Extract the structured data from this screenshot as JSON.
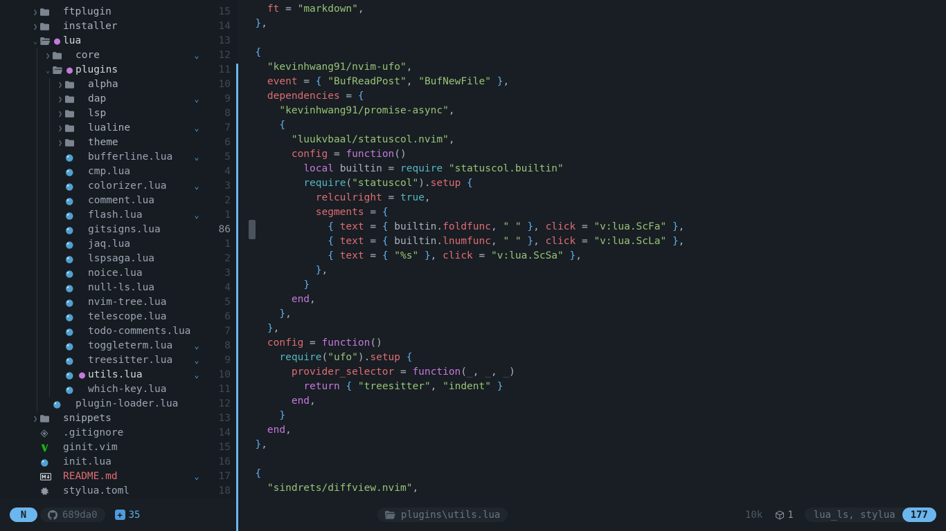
{
  "sidebar": {
    "name": "file-explorer",
    "items": [
      {
        "depth": 1,
        "type": "folder",
        "state": "closed",
        "label": "ftplugin",
        "num": "15",
        "fold": false,
        "mod": false
      },
      {
        "depth": 1,
        "type": "folder",
        "state": "closed",
        "label": "installer",
        "num": "14",
        "fold": false,
        "mod": false
      },
      {
        "depth": 1,
        "type": "folder",
        "state": "open",
        "label": "lua",
        "num": "13",
        "fold": false,
        "mod": true
      },
      {
        "depth": 2,
        "type": "folder",
        "state": "closed",
        "label": "core",
        "num": "12",
        "fold": true,
        "mod": false
      },
      {
        "depth": 2,
        "type": "folder",
        "state": "open",
        "label": "plugins",
        "num": "11",
        "fold": false,
        "mod": true
      },
      {
        "depth": 3,
        "type": "folder",
        "state": "closed",
        "label": "alpha",
        "num": "10",
        "fold": false,
        "mod": false
      },
      {
        "depth": 3,
        "type": "folder",
        "state": "closed",
        "label": "dap",
        "num": "9",
        "fold": true,
        "mod": false
      },
      {
        "depth": 3,
        "type": "folder",
        "state": "closed",
        "label": "lsp",
        "num": "8",
        "fold": false,
        "mod": false
      },
      {
        "depth": 3,
        "type": "folder",
        "state": "closed",
        "label": "lualine",
        "num": "7",
        "fold": true,
        "mod": false
      },
      {
        "depth": 3,
        "type": "folder",
        "state": "closed",
        "label": "theme",
        "num": "6",
        "fold": false,
        "mod": false
      },
      {
        "depth": 3,
        "type": "lua",
        "label": "bufferline.lua",
        "num": "5",
        "fold": true,
        "mod": false
      },
      {
        "depth": 3,
        "type": "lua",
        "label": "cmp.lua",
        "num": "4",
        "fold": false,
        "mod": false
      },
      {
        "depth": 3,
        "type": "lua",
        "label": "colorizer.lua",
        "num": "3",
        "fold": true,
        "mod": false
      },
      {
        "depth": 3,
        "type": "lua",
        "label": "comment.lua",
        "num": "2",
        "fold": false,
        "mod": false
      },
      {
        "depth": 3,
        "type": "lua",
        "label": "flash.lua",
        "num": "1",
        "fold": true,
        "mod": false
      },
      {
        "depth": 3,
        "type": "lua",
        "label": "gitsigns.lua",
        "num": "86",
        "current": true,
        "fold": false,
        "mod": false
      },
      {
        "depth": 3,
        "type": "lua",
        "label": "jaq.lua",
        "num": "1",
        "fold": false,
        "mod": false
      },
      {
        "depth": 3,
        "type": "lua",
        "label": "lspsaga.lua",
        "num": "2",
        "fold": false,
        "mod": false
      },
      {
        "depth": 3,
        "type": "lua",
        "label": "noice.lua",
        "num": "3",
        "fold": false,
        "mod": false
      },
      {
        "depth": 3,
        "type": "lua",
        "label": "null-ls.lua",
        "num": "4",
        "fold": false,
        "mod": false
      },
      {
        "depth": 3,
        "type": "lua",
        "label": "nvim-tree.lua",
        "num": "5",
        "fold": false,
        "mod": false
      },
      {
        "depth": 3,
        "type": "lua",
        "label": "telescope.lua",
        "num": "6",
        "fold": false,
        "mod": false
      },
      {
        "depth": 3,
        "type": "lua",
        "label": "todo-comments.lua",
        "num": "7",
        "fold": false,
        "mod": false
      },
      {
        "depth": 3,
        "type": "lua",
        "label": "toggleterm.lua",
        "num": "8",
        "fold": true,
        "mod": false
      },
      {
        "depth": 3,
        "type": "lua",
        "label": "treesitter.lua",
        "num": "9",
        "fold": true,
        "mod": false
      },
      {
        "depth": 3,
        "type": "lua",
        "label": "utils.lua",
        "num": "10",
        "fold": true,
        "mod": true
      },
      {
        "depth": 3,
        "type": "lua",
        "label": "which-key.lua",
        "num": "11",
        "fold": false,
        "mod": false
      },
      {
        "depth": 2,
        "type": "lua",
        "label": "plugin-loader.lua",
        "num": "12",
        "fold": false,
        "mod": false
      },
      {
        "depth": 1,
        "type": "folder",
        "state": "closed",
        "label": "snippets",
        "num": "13",
        "fold": false,
        "mod": false
      },
      {
        "depth": 1,
        "type": "gitignore",
        "label": ".gitignore",
        "num": "14",
        "fold": false,
        "mod": false
      },
      {
        "depth": 1,
        "type": "vim",
        "label": "ginit.vim",
        "num": "15",
        "fold": false,
        "mod": false
      },
      {
        "depth": 1,
        "type": "lua",
        "label": "init.lua",
        "num": "16",
        "fold": false,
        "mod": false
      },
      {
        "depth": 1,
        "type": "md",
        "label": "README.md",
        "num": "17",
        "fold": true,
        "mod": false,
        "red": true
      },
      {
        "depth": 1,
        "type": "toml",
        "label": "stylua.toml",
        "num": "18",
        "fold": false,
        "mod": false
      }
    ]
  },
  "editor": {
    "name": "code-editor",
    "language": "lua",
    "lines": [
      [
        {
          "t": "    ",
          "c": "s-punc"
        },
        {
          "t": "ft",
          "c": "s-key"
        },
        {
          "t": " = ",
          "c": "s-op"
        },
        {
          "t": "\"markdown\"",
          "c": "s-str"
        },
        {
          "t": ",",
          "c": "s-punc"
        }
      ],
      [
        {
          "t": "  ",
          "c": "s-punc"
        },
        {
          "t": "}",
          "c": "s-brace"
        },
        {
          "t": ",",
          "c": "s-punc"
        }
      ],
      [],
      [
        {
          "t": "  ",
          "c": "s-punc"
        },
        {
          "t": "{",
          "c": "s-brace"
        }
      ],
      [
        {
          "t": "    ",
          "c": "s-punc"
        },
        {
          "t": "\"kevinhwang91/nvim-ufo\"",
          "c": "s-str"
        },
        {
          "t": ",",
          "c": "s-punc"
        }
      ],
      [
        {
          "t": "    ",
          "c": "s-punc"
        },
        {
          "t": "event",
          "c": "s-key"
        },
        {
          "t": " = ",
          "c": "s-op"
        },
        {
          "t": "{",
          "c": "s-brace"
        },
        {
          "t": " ",
          "c": "s-punc"
        },
        {
          "t": "\"BufReadPost\"",
          "c": "s-str"
        },
        {
          "t": ", ",
          "c": "s-punc"
        },
        {
          "t": "\"BufNewFile\"",
          "c": "s-str"
        },
        {
          "t": " ",
          "c": "s-punc"
        },
        {
          "t": "}",
          "c": "s-brace"
        },
        {
          "t": ",",
          "c": "s-punc"
        }
      ],
      [
        {
          "t": "    ",
          "c": "s-punc"
        },
        {
          "t": "dependencies",
          "c": "s-key"
        },
        {
          "t": " = ",
          "c": "s-op"
        },
        {
          "t": "{",
          "c": "s-brace"
        }
      ],
      [
        {
          "t": "      ",
          "c": "s-punc"
        },
        {
          "t": "\"kevinhwang91/promise-async\"",
          "c": "s-str"
        },
        {
          "t": ",",
          "c": "s-punc"
        }
      ],
      [
        {
          "t": "      ",
          "c": "s-punc"
        },
        {
          "t": "{",
          "c": "s-brace"
        }
      ],
      [
        {
          "t": "        ",
          "c": "s-punc"
        },
        {
          "t": "\"luukvbaal/statuscol.nvim\"",
          "c": "s-str"
        },
        {
          "t": ",",
          "c": "s-punc"
        }
      ],
      [
        {
          "t": "        ",
          "c": "s-punc"
        },
        {
          "t": "config",
          "c": "s-key"
        },
        {
          "t": " = ",
          "c": "s-op"
        },
        {
          "t": "function",
          "c": "s-kw"
        },
        {
          "t": "()",
          "c": "s-punc"
        }
      ],
      [
        {
          "t": "          ",
          "c": "s-punc"
        },
        {
          "t": "local",
          "c": "s-kw"
        },
        {
          "t": " builtin",
          "c": "s-id"
        },
        {
          "t": " = ",
          "c": "s-op"
        },
        {
          "t": "require",
          "c": "s-fn"
        },
        {
          "t": " ",
          "c": "s-punc"
        },
        {
          "t": "\"statuscol.builtin\"",
          "c": "s-str"
        }
      ],
      [
        {
          "t": "          ",
          "c": "s-punc"
        },
        {
          "t": "require",
          "c": "s-fn"
        },
        {
          "t": "(",
          "c": "s-punc"
        },
        {
          "t": "\"statuscol\"",
          "c": "s-str"
        },
        {
          "t": ").",
          "c": "s-punc"
        },
        {
          "t": "setup",
          "c": "s-key"
        },
        {
          "t": " ",
          "c": "s-punc"
        },
        {
          "t": "{",
          "c": "s-brace"
        }
      ],
      [
        {
          "t": "            ",
          "c": "s-punc"
        },
        {
          "t": "relculright",
          "c": "s-key"
        },
        {
          "t": " = ",
          "c": "s-op"
        },
        {
          "t": "true",
          "c": "s-fn"
        },
        {
          "t": ",",
          "c": "s-punc"
        }
      ],
      [
        {
          "t": "            ",
          "c": "s-punc"
        },
        {
          "t": "segments",
          "c": "s-key"
        },
        {
          "t": " = ",
          "c": "s-op"
        },
        {
          "t": "{",
          "c": "s-brace"
        }
      ],
      [
        {
          "t": "              ",
          "c": "s-punc"
        },
        {
          "t": "{",
          "c": "s-brace"
        },
        {
          "t": " ",
          "c": "s-punc"
        },
        {
          "t": "text",
          "c": "s-key"
        },
        {
          "t": " = ",
          "c": "s-op"
        },
        {
          "t": "{",
          "c": "s-brace"
        },
        {
          "t": " builtin.",
          "c": "s-id"
        },
        {
          "t": "foldfunc",
          "c": "s-key"
        },
        {
          "t": ", ",
          "c": "s-punc"
        },
        {
          "t": "\" \"",
          "c": "s-str"
        },
        {
          "t": " ",
          "c": "s-punc"
        },
        {
          "t": "}",
          "c": "s-brace"
        },
        {
          "t": ", ",
          "c": "s-punc"
        },
        {
          "t": "click",
          "c": "s-key"
        },
        {
          "t": " = ",
          "c": "s-op"
        },
        {
          "t": "\"v:lua.ScFa\"",
          "c": "s-str"
        },
        {
          "t": " ",
          "c": "s-punc"
        },
        {
          "t": "}",
          "c": "s-brace"
        },
        {
          "t": ",",
          "c": "s-punc"
        }
      ],
      [
        {
          "t": "              ",
          "c": "s-punc"
        },
        {
          "t": "{",
          "c": "s-brace"
        },
        {
          "t": " ",
          "c": "s-punc"
        },
        {
          "t": "text",
          "c": "s-key"
        },
        {
          "t": " = ",
          "c": "s-op"
        },
        {
          "t": "{",
          "c": "s-brace"
        },
        {
          "t": " builtin.",
          "c": "s-id"
        },
        {
          "t": "lnumfunc",
          "c": "s-key"
        },
        {
          "t": ", ",
          "c": "s-punc"
        },
        {
          "t": "\" \"",
          "c": "s-str"
        },
        {
          "t": " ",
          "c": "s-punc"
        },
        {
          "t": "}",
          "c": "s-brace"
        },
        {
          "t": ", ",
          "c": "s-punc"
        },
        {
          "t": "click",
          "c": "s-key"
        },
        {
          "t": " = ",
          "c": "s-op"
        },
        {
          "t": "\"v:lua.ScLa\"",
          "c": "s-str"
        },
        {
          "t": " ",
          "c": "s-punc"
        },
        {
          "t": "}",
          "c": "s-brace"
        },
        {
          "t": ",",
          "c": "s-punc"
        }
      ],
      [
        {
          "t": "              ",
          "c": "s-punc"
        },
        {
          "t": "{",
          "c": "s-brace"
        },
        {
          "t": " ",
          "c": "s-punc"
        },
        {
          "t": "text",
          "c": "s-key"
        },
        {
          "t": " = ",
          "c": "s-op"
        },
        {
          "t": "{",
          "c": "s-brace"
        },
        {
          "t": " ",
          "c": "s-punc"
        },
        {
          "t": "\"%s\"",
          "c": "s-str"
        },
        {
          "t": " ",
          "c": "s-punc"
        },
        {
          "t": "}",
          "c": "s-brace"
        },
        {
          "t": ", ",
          "c": "s-punc"
        },
        {
          "t": "click",
          "c": "s-key"
        },
        {
          "t": " = ",
          "c": "s-op"
        },
        {
          "t": "\"v:lua.ScSa\"",
          "c": "s-str"
        },
        {
          "t": " ",
          "c": "s-punc"
        },
        {
          "t": "}",
          "c": "s-brace"
        },
        {
          "t": ",",
          "c": "s-punc"
        }
      ],
      [
        {
          "t": "            ",
          "c": "s-punc"
        },
        {
          "t": "}",
          "c": "s-brace"
        },
        {
          "t": ",",
          "c": "s-punc"
        }
      ],
      [
        {
          "t": "          ",
          "c": "s-punc"
        },
        {
          "t": "}",
          "c": "s-brace"
        }
      ],
      [
        {
          "t": "        ",
          "c": "s-punc"
        },
        {
          "t": "end",
          "c": "s-kw"
        },
        {
          "t": ",",
          "c": "s-punc"
        }
      ],
      [
        {
          "t": "      ",
          "c": "s-punc"
        },
        {
          "t": "}",
          "c": "s-brace"
        },
        {
          "t": ",",
          "c": "s-punc"
        }
      ],
      [
        {
          "t": "    ",
          "c": "s-punc"
        },
        {
          "t": "}",
          "c": "s-brace"
        },
        {
          "t": ",",
          "c": "s-punc"
        }
      ],
      [
        {
          "t": "    ",
          "c": "s-punc"
        },
        {
          "t": "config",
          "c": "s-key"
        },
        {
          "t": " = ",
          "c": "s-op"
        },
        {
          "t": "function",
          "c": "s-kw"
        },
        {
          "t": "()",
          "c": "s-punc"
        }
      ],
      [
        {
          "t": "      ",
          "c": "s-punc"
        },
        {
          "t": "require",
          "c": "s-fn"
        },
        {
          "t": "(",
          "c": "s-punc"
        },
        {
          "t": "\"ufo\"",
          "c": "s-str"
        },
        {
          "t": ").",
          "c": "s-punc"
        },
        {
          "t": "setup",
          "c": "s-key"
        },
        {
          "t": " ",
          "c": "s-punc"
        },
        {
          "t": "{",
          "c": "s-brace"
        }
      ],
      [
        {
          "t": "        ",
          "c": "s-punc"
        },
        {
          "t": "provider_selector",
          "c": "s-key"
        },
        {
          "t": " = ",
          "c": "s-op"
        },
        {
          "t": "function",
          "c": "s-kw"
        },
        {
          "t": "(",
          "c": "s-punc"
        },
        {
          "t": "_",
          "c": "s-param"
        },
        {
          "t": ", ",
          "c": "s-punc"
        },
        {
          "t": "_",
          "c": "s-param"
        },
        {
          "t": ", ",
          "c": "s-punc"
        },
        {
          "t": "_",
          "c": "s-param"
        },
        {
          "t": ")",
          "c": "s-punc"
        }
      ],
      [
        {
          "t": "          ",
          "c": "s-punc"
        },
        {
          "t": "return",
          "c": "s-kw"
        },
        {
          "t": " ",
          "c": "s-punc"
        },
        {
          "t": "{",
          "c": "s-brace"
        },
        {
          "t": " ",
          "c": "s-punc"
        },
        {
          "t": "\"treesitter\"",
          "c": "s-str"
        },
        {
          "t": ", ",
          "c": "s-punc"
        },
        {
          "t": "\"indent\"",
          "c": "s-str"
        },
        {
          "t": " ",
          "c": "s-punc"
        },
        {
          "t": "}",
          "c": "s-brace"
        }
      ],
      [
        {
          "t": "        ",
          "c": "s-punc"
        },
        {
          "t": "end",
          "c": "s-kw"
        },
        {
          "t": ",",
          "c": "s-punc"
        }
      ],
      [
        {
          "t": "      ",
          "c": "s-punc"
        },
        {
          "t": "}",
          "c": "s-brace"
        }
      ],
      [
        {
          "t": "    ",
          "c": "s-punc"
        },
        {
          "t": "end",
          "c": "s-kw"
        },
        {
          "t": ",",
          "c": "s-punc"
        }
      ],
      [
        {
          "t": "  ",
          "c": "s-punc"
        },
        {
          "t": "}",
          "c": "s-brace"
        },
        {
          "t": ",",
          "c": "s-punc"
        }
      ],
      [],
      [
        {
          "t": "  ",
          "c": "s-punc"
        },
        {
          "t": "{",
          "c": "s-brace"
        }
      ],
      [
        {
          "t": "    ",
          "c": "s-punc"
        },
        {
          "t": "\"sindrets/diffview.nvim\"",
          "c": "s-str"
        },
        {
          "t": ",",
          "c": "s-punc"
        }
      ]
    ]
  },
  "statusbar": {
    "mode": "N",
    "git_branch_hash": "689da0",
    "diff_added": "35",
    "file_path": "plugins\\utils.lua",
    "file_size": "10k",
    "package_count": "1",
    "lsp_servers": "lua_ls, stylua",
    "line_count": "177"
  }
}
